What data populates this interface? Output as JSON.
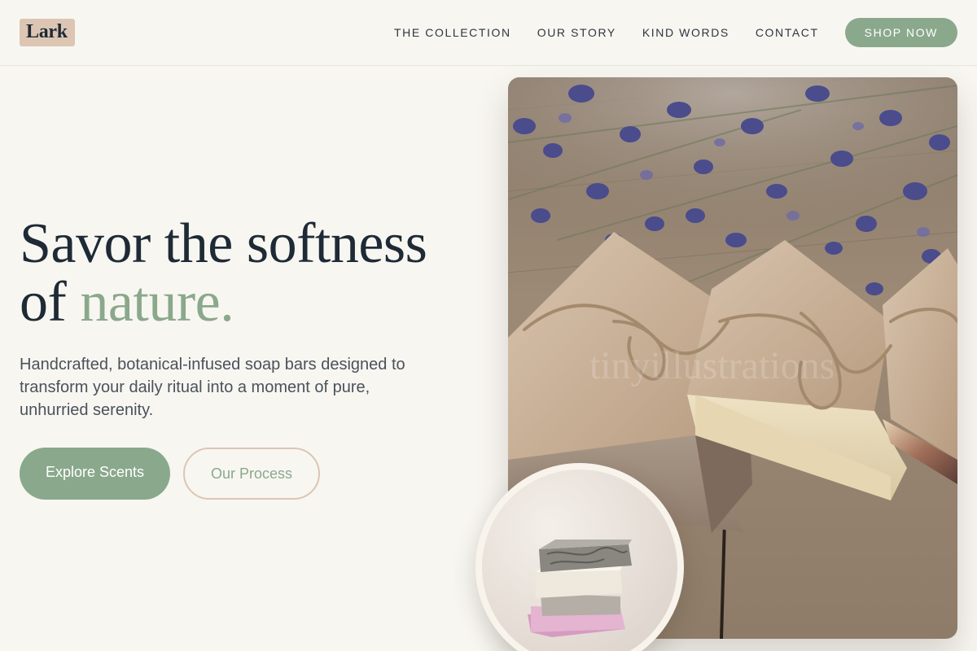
{
  "brand": {
    "name": "Lark"
  },
  "nav": {
    "links": [
      "THE COLLECTION",
      "OUR STORY",
      "KIND WORDS",
      "CONTACT"
    ],
    "cta": "SHOP NOW"
  },
  "hero": {
    "title_line1": "Savor the softness",
    "title_line2_prefix": "of ",
    "title_line2_accent": "nature.",
    "subtitle": "Handcrafted, botanical-infused soap bars designed to transform your daily ritual into a moment of pure, unhurried serenity.",
    "primary_button": "Explore Scents",
    "secondary_button": "Our Process"
  },
  "images": {
    "main": "lavender-soap-bars-photo",
    "circle": "stacked-soap-bars-photo"
  },
  "colors": {
    "background": "#f8f6f1",
    "accent_sage": "#8aa88c",
    "accent_tan": "#dcc6b3",
    "text_dark": "#1e2a35"
  }
}
